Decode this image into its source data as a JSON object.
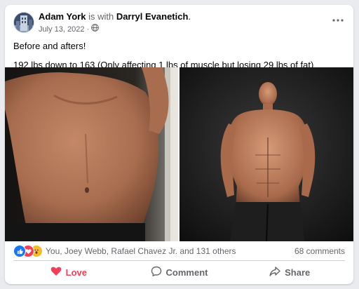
{
  "post": {
    "author": "Adam York",
    "with_text": "is with",
    "tagged": "Darryl Evanetich",
    "tagged_suffix": ".",
    "date": "July 13, 2022",
    "separator": "·",
    "privacy_icon": "globe-icon",
    "more_icon": "more-horizontal-icon",
    "text_lines": [
      "Before and afters!",
      "192 lbs down to 163 (Only affecting 1 lbs of muscle but losing 29 lbs of fat)"
    ]
  },
  "photos": [
    {
      "name": "before-photo"
    },
    {
      "name": "after-photo"
    }
  ],
  "reactions": {
    "icons": [
      "like-icon",
      "love-icon",
      "wow-icon"
    ],
    "summary": "You, Joey Webb, Rafael Chavez Jr. and 131 others",
    "comments": "68 comments"
  },
  "actions": {
    "love": "Love",
    "comment": "Comment",
    "share": "Share"
  },
  "colors": {
    "like_blue": "#1877f2",
    "love_red": "#f33e58",
    "wow_yellow": "#f7b928",
    "secondary_text": "#65676b"
  }
}
